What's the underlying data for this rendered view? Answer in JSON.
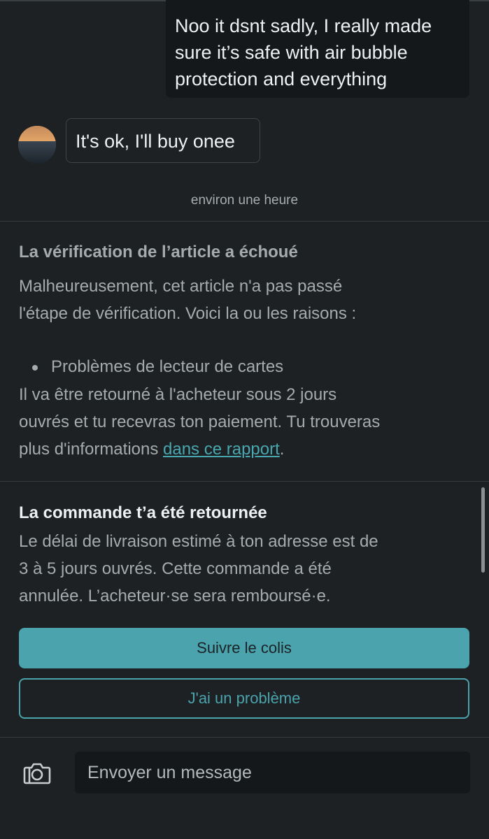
{
  "conversation": {
    "outgoing_message": {
      "lines": [
        "Noo it dsnt sadly, I really made",
        "sure it’s safe with air bubble",
        "protection and everything"
      ]
    },
    "incoming_message": {
      "text": "It's ok, I'll buy onee"
    },
    "timestamp": "environ une heure"
  },
  "verification_notice": {
    "title": "La vérification de l’article a échoué",
    "intro_lines": [
      "Malheureusement, cet article n'a pas passé",
      "l'étape de vérification. Voici la ou les raisons :"
    ],
    "reasons": [
      "Problèmes de lecteur de cartes"
    ],
    "body_line_1": "Il va être retourné à l'acheteur sous 2 jours",
    "body_line_2": "ouvrés et tu recevras ton paiement. Tu trouveras",
    "body_line_3_prefix": "plus d'informations ",
    "report_link": "dans ce rapport",
    "body_line_3_suffix": "."
  },
  "order_returned": {
    "title": "La commande t’a été retournée",
    "lines": [
      "Le délai de livraison estimé à ton adresse est de",
      "3 à 5 jours ouvrés. Cette commande a été",
      "annulée. L’acheteur·se sera remboursé·e."
    ],
    "track_button": "Suivre le colis",
    "problem_button": "J'ai un problème"
  },
  "composer": {
    "camera_icon": "camera-icon",
    "placeholder": "Envoyer un message"
  },
  "colors": {
    "background": "#1d2123",
    "accent": "#4aa3ad",
    "link": "#49a7b0"
  }
}
